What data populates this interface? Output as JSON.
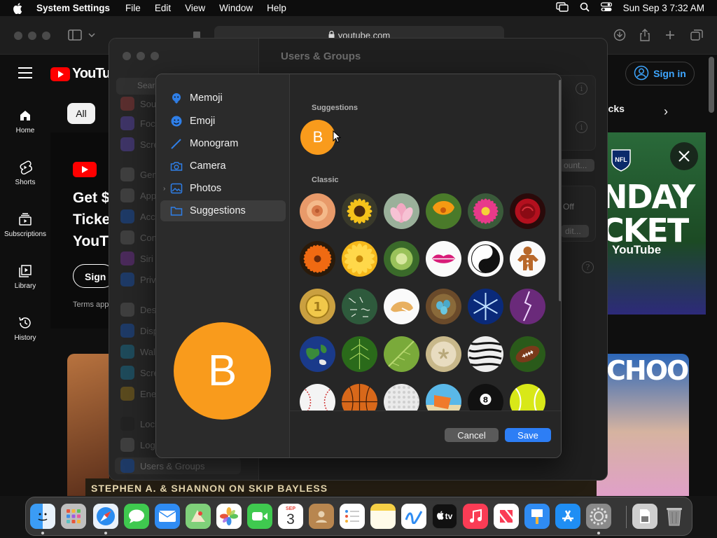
{
  "menubar": {
    "app_name": "System Settings",
    "items": [
      "File",
      "Edit",
      "View",
      "Window",
      "Help"
    ],
    "clock": "Sun Sep 3  7:32 AM"
  },
  "browser": {
    "url": "youtube.com",
    "youtube": {
      "logo_text": "YouTube",
      "sign_in": "Sign in",
      "nav": [
        "Home",
        "Shorts",
        "Subscriptions",
        "Library",
        "History"
      ],
      "chip_all": "All",
      "chip_right": "ucks",
      "promo_heading_lines": [
        "Get $",
        "Ticke",
        "YouT"
      ],
      "promo_sign_in": "Sign i",
      "promo_terms": "Terms app",
      "promo_right_lines": [
        "NDAY",
        "CKET"
      ],
      "promo_right_brand": "YouTube",
      "thumb_right_text": "CHOOL",
      "bottom_banner": "STEPHEN A. & SHANNON ON SKIP BAYLESS"
    }
  },
  "settings": {
    "title": "Users & Groups",
    "search_placeholder": "Search",
    "sidebar_items": [
      "Sou",
      "Focu",
      "Scre",
      "Gen",
      "App",
      "Acce",
      "Con",
      "Siri",
      "Priv",
      "Des",
      "Disp",
      "Wall",
      "Scre",
      "Ener",
      "Lock",
      "Logi",
      "Users & Groups"
    ],
    "pane_buttons": [
      "ount...",
      "Off",
      "dit..."
    ]
  },
  "dialog": {
    "categories": [
      {
        "label": "Memoji",
        "icon": "memoji-icon"
      },
      {
        "label": "Emoji",
        "icon": "emoji-icon"
      },
      {
        "label": "Monogram",
        "icon": "monogram-pen-icon"
      },
      {
        "label": "Camera",
        "icon": "camera-icon"
      },
      {
        "label": "Photos",
        "icon": "photos-icon"
      },
      {
        "label": "Suggestions",
        "icon": "suggestions-folder-icon"
      }
    ],
    "selected_category": "Suggestions",
    "large_avatar_letter": "B",
    "sections": {
      "suggestions": "Suggestions",
      "classic": "Classic"
    },
    "suggestion_letter": "B",
    "classic_images": [
      "peach-rose",
      "sunflower",
      "lotus",
      "orange-poppy",
      "pink-dahlia",
      "red-rose",
      "orange-flower",
      "yellow-daisy",
      "green-dandelion",
      "lips",
      "yin-yang",
      "gingerbread-man",
      "gold-medal",
      "chalkboard",
      "fortune-cookie",
      "blue-eggs-nest",
      "snowflake",
      "lightning",
      "earth",
      "leaf",
      "green-leaf",
      "sand-dollar",
      "zebra",
      "football",
      "baseball",
      "basketball",
      "golf-ball",
      "beach-chair",
      "eight-ball",
      "tennis-ball"
    ],
    "cancel_label": "Cancel",
    "save_label": "Save"
  },
  "dock": {
    "apps": [
      "Finder",
      "Launchpad",
      "Safari",
      "Messages",
      "Mail",
      "Maps",
      "Photos",
      "FaceTime",
      "Calendar",
      "Contacts",
      "Reminders",
      "Notes",
      "Freeform",
      "TV",
      "Music",
      "News",
      "Keynote",
      "App Store",
      "System Settings",
      "Downloads",
      "Trash"
    ],
    "calendar_month": "SEP",
    "calendar_day": "3",
    "tv_label": "tv"
  },
  "colors": {
    "accent_blue": "#2d7ef5",
    "avatar_orange": "#f99b1c",
    "youtube_red": "#ff0000"
  }
}
